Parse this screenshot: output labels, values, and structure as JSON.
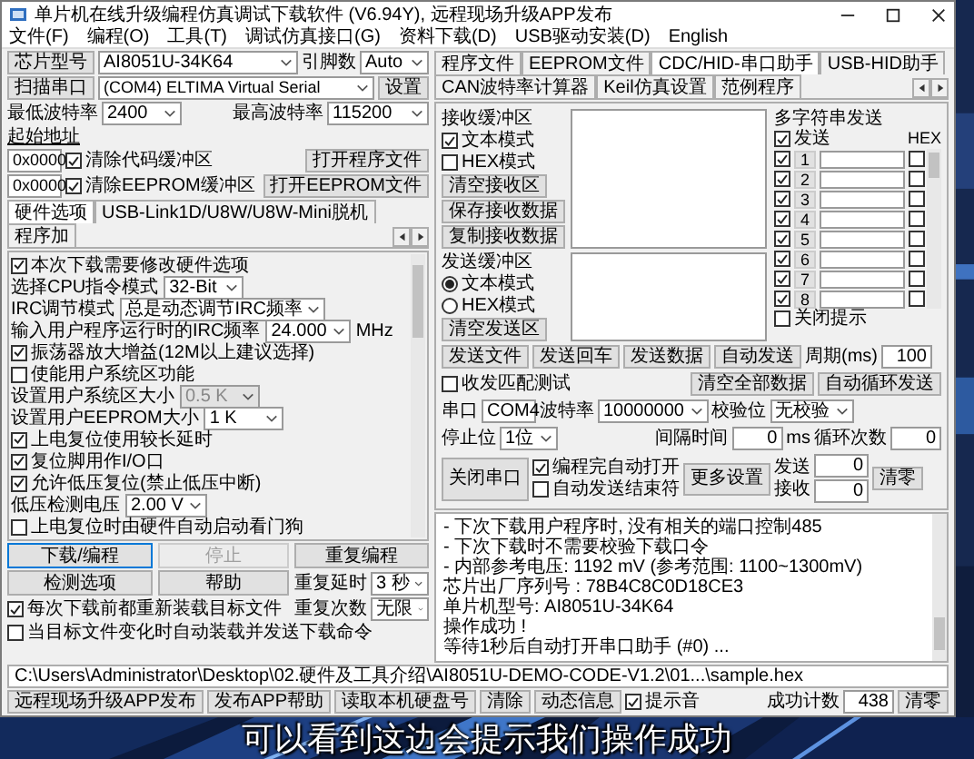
{
  "window": {
    "title": "单片机在线升级编程仿真调试下载软件 (V6.94Y), 远程现场升级APP发布"
  },
  "menu": [
    "文件(F)",
    "编程(O)",
    "工具(T)",
    "调试仿真接口(G)",
    "资料下载(D)",
    "USB驱动安装(D)",
    "English"
  ],
  "left": {
    "chip": {
      "label": "芯片型号",
      "value": "AI8051U-34K64",
      "pins_label": "引脚数",
      "pins": "Auto"
    },
    "port": {
      "button": "扫描串口",
      "value": "(COM4) ELTIMA Virtual Serial",
      "settings": "设置"
    },
    "baud": {
      "min_label": "最低波特率",
      "min": "2400",
      "max_label": "最高波特率",
      "max": "115200"
    },
    "start_label": "起始地址",
    "buffers": [
      {
        "address": "0x0000",
        "label": "清除代码缓冲区",
        "checked": true,
        "button": "打开程序文件"
      },
      {
        "address": "0x0000",
        "label": "清除EEPROM缓冲区",
        "checked": true,
        "button": "打开EEPROM文件"
      }
    ],
    "tabs": [
      {
        "label": "硬件选项",
        "selected": true
      },
      {
        "label": "USB-Link1D/U8W/U8W-Mini脱机",
        "selected": false
      },
      {
        "label": "程序加",
        "selected": false
      }
    ],
    "options": [
      {
        "kind": "check",
        "label": "本次下载需要修改硬件选项",
        "checked": true
      },
      {
        "kind": "select",
        "label": "选择CPU指令模式",
        "value": "32-Bit",
        "disabled": false
      },
      {
        "kind": "select",
        "label": "IRC调节模式",
        "value": "总是动态调节IRC频率",
        "disabled": false
      },
      {
        "kind": "select",
        "label": "输入用户程序运行时的IRC频率",
        "value": "24.000",
        "unit": "MHz",
        "disabled": false
      },
      {
        "kind": "check",
        "label": "振荡器放大增益(12M以上建议选择)",
        "checked": true
      },
      {
        "kind": "check",
        "label": "使能用户系统区功能",
        "checked": false
      },
      {
        "kind": "select",
        "label": "设置用户系统区大小",
        "value": "0.5 K",
        "disabled": true
      },
      {
        "kind": "select",
        "label": "设置用户EEPROM大小",
        "value": "1 K",
        "disabled": false
      },
      {
        "kind": "check",
        "label": "上电复位使用较长延时",
        "checked": true
      },
      {
        "kind": "check",
        "label": "复位脚用作I/O口",
        "checked": true
      },
      {
        "kind": "check",
        "label": "允许低压复位(禁止低压中断)",
        "checked": true
      },
      {
        "kind": "select",
        "label": "低压检测电压",
        "value": "2.00 V",
        "disabled": false
      },
      {
        "kind": "check",
        "label": "上电复位时由硬件自动启动看门狗",
        "checked": false
      }
    ],
    "buttons": [
      {
        "label": "下载/编程",
        "disabled": false,
        "focused": true
      },
      {
        "label": "停止",
        "disabled": true,
        "focused": false
      },
      {
        "label": "重复编程",
        "disabled": false,
        "focused": false
      },
      {
        "label": "检测选项",
        "disabled": false,
        "focused": false
      },
      {
        "label": "帮助",
        "disabled": false,
        "focused": false
      }
    ],
    "repeat_delay": {
      "label": "重复延时",
      "value": "3 秒"
    },
    "repeat_count": {
      "label": "重复次数",
      "value": "无限"
    },
    "reload": [
      {
        "label": "每次下载前都重新装载目标文件",
        "checked": true
      },
      {
        "label": "当目标文件变化时自动装载并发送下载命令",
        "checked": false
      }
    ]
  },
  "right": {
    "tabs": [
      {
        "label": "程序文件",
        "selected": false
      },
      {
        "label": "EEPROM文件",
        "selected": false
      },
      {
        "label": "CDC/HID-串口助手",
        "selected": true
      },
      {
        "label": "USB-HID助手",
        "selected": false
      },
      {
        "label": "CAN波特率计算器",
        "selected": false
      },
      {
        "label": "Keil仿真设置",
        "selected": false
      },
      {
        "label": "范例程序",
        "selected": false
      }
    ],
    "receive": {
      "title": "接收缓冲区",
      "modes": [
        {
          "label": "文本模式",
          "checked": true
        },
        {
          "label": "HEX模式",
          "checked": false
        }
      ],
      "buttons": [
        "清空接收区",
        "保存接收数据",
        "复制接收数据"
      ]
    },
    "send": {
      "title": "发送缓冲区",
      "modes": [
        {
          "label": "文本模式",
          "selected": true
        },
        {
          "label": "HEX模式",
          "selected": false
        }
      ],
      "buttons": [
        "清空发送区"
      ]
    },
    "multi_send": {
      "title": "多字符串发送",
      "send": {
        "label": "发送",
        "checked": true
      },
      "hex_label": "HEX",
      "rows": [
        {
          "number": "1",
          "checked": true,
          "hex": false
        },
        {
          "number": "2",
          "checked": true,
          "hex": false
        },
        {
          "number": "3",
          "checked": true,
          "hex": false
        },
        {
          "number": "4",
          "checked": true,
          "hex": false
        },
        {
          "number": "5",
          "checked": true,
          "hex": false
        },
        {
          "number": "6",
          "checked": true,
          "hex": false
        },
        {
          "number": "7",
          "checked": true,
          "hex": false
        },
        {
          "number": "8",
          "checked": true,
          "hex": false
        }
      ],
      "close_hint": {
        "label": "关闭提示",
        "checked": false
      },
      "buttons": [
        "清空全部数据",
        "自动循环发送"
      ],
      "interval_label": "间隔时间",
      "interval": "0",
      "interval_unit": "ms",
      "loops_label": "循环次数",
      "loops": "0"
    },
    "send_actions": {
      "buttons": [
        "发送文件",
        "发送回车",
        "发送数据",
        "自动发送"
      ],
      "period_label": "周期(ms)",
      "period": "100",
      "match": {
        "label": "收发匹配测试",
        "checked": false
      }
    },
    "serial": {
      "port_label": "串口",
      "port": "COM4",
      "baud_label": "波特率",
      "baud": "10000000",
      "parity_label": "校验位",
      "parity": "无校验",
      "stop_label": "停止位",
      "stop": "1位"
    },
    "connection": {
      "button": "关闭串口",
      "options": [
        {
          "label": "编程完自动打开",
          "checked": true
        },
        {
          "label": "自动发送结束符",
          "checked": false
        }
      ],
      "more": "更多设置",
      "sent_label": "发送",
      "sent": "0",
      "received_label": "接收",
      "received": "0",
      "clear": "清零"
    },
    "log": [
      "- 下次下载用户程序时, 没有相关的端口控制485",
      "- 下次下载时不需要校验下载口令",
      "- 内部参考电压: 1192 mV (参考范围: 1100~1300mV)",
      "芯片出厂序列号 : 78B4C8C0D18CE3",
      "单片机型号: AI8051U-34K64",
      "操作成功 !",
      "等待1秒后自动打开串口助手 (#0) ..."
    ]
  },
  "path": "C:\\Users\\Administrator\\Desktop\\02.硬件及工具介绍\\AI8051U-DEMO-CODE-V1.2\\01...\\sample.hex",
  "bottom_bar": {
    "buttons": [
      "远程现场升级APP发布",
      "发布APP帮助",
      "读取本机硬盘号",
      "清除",
      "动态信息"
    ],
    "beep": {
      "label": "提示音",
      "checked": true
    },
    "count_label": "成功计数",
    "count": "438",
    "clear": "清零"
  },
  "subtitle": "可以看到这边会提示我们操作成功"
}
